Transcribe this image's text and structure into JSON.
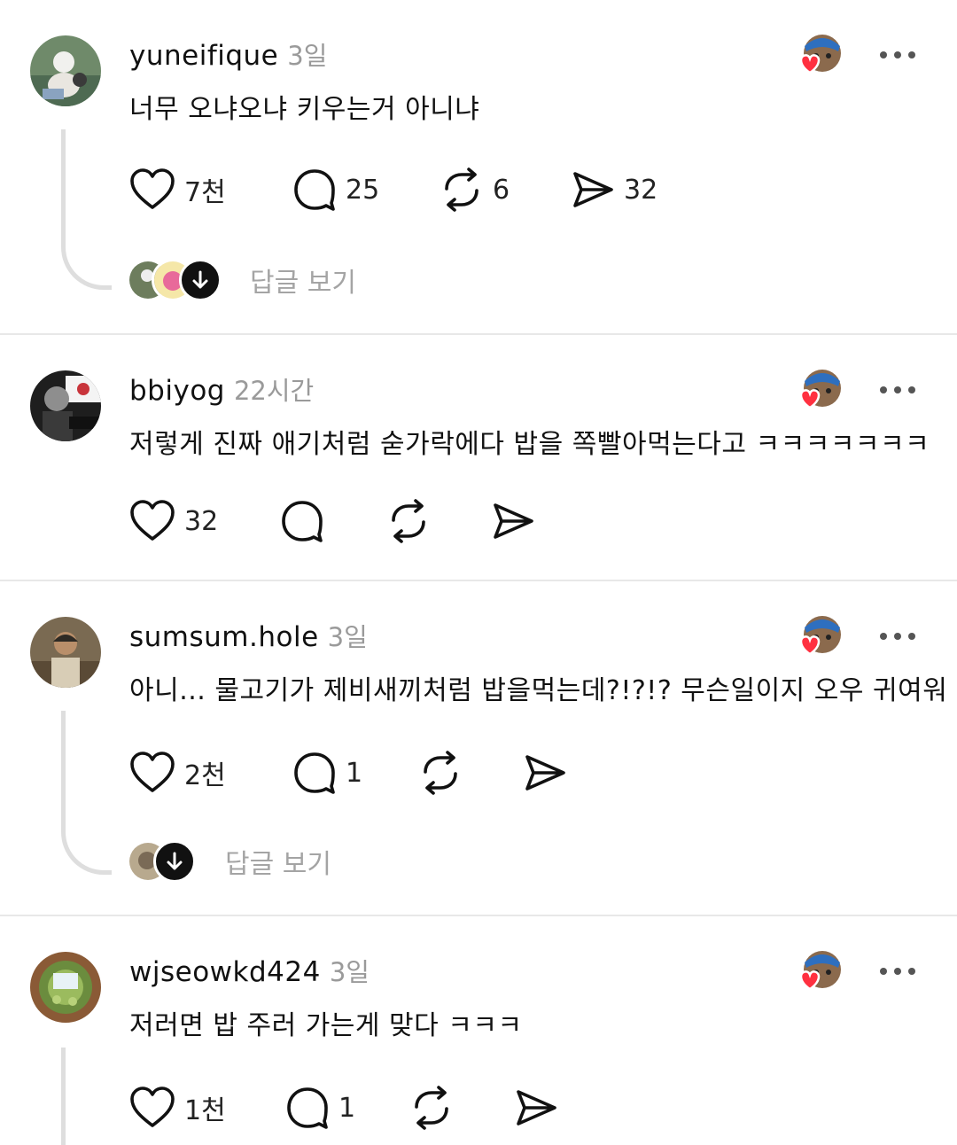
{
  "posts": [
    {
      "username": "yuneifique",
      "time": "3일",
      "text": "너무 오냐오냐 키우는거 아니냐",
      "likes": "7천",
      "comments": "25",
      "reposts": "6",
      "shares": "32",
      "view_replies": "답글 보기"
    },
    {
      "username": "bbiyog",
      "time": "22시간",
      "text": "저렇게 진짜 애기처럼 숟가락에다 밥을 쪽빨아먹는다고 ㅋㅋㅋㅋㅋㅋㅋ",
      "likes": "32"
    },
    {
      "username": "sumsum.hole",
      "time": "3일",
      "text": "아니... 물고기가 제비새끼처럼 밥을먹는데?!?!? 무슨일이지 오우 귀여워",
      "likes": "2천",
      "comments": "1",
      "view_replies": "답글 보기"
    },
    {
      "username": "wjseowkd424",
      "time": "3일",
      "text": "저러면 밥 주러 가는게 맞다 ㅋㅋㅋ",
      "likes": "1천",
      "comments": "1"
    }
  ],
  "icons": {
    "like": "heart-icon",
    "comment": "comment-bubble-icon",
    "repost": "repost-icon",
    "share": "send-icon",
    "more": "more-dots-icon",
    "liked_by_author": "red-heart-badge-icon",
    "view_replies_arrow": "arrow-down-icon"
  },
  "colors": {
    "liked_heart": "#ff3040",
    "muted_text": "#9a9a9a",
    "divider": "#e8e8e8",
    "thread_line": "#dedede"
  }
}
